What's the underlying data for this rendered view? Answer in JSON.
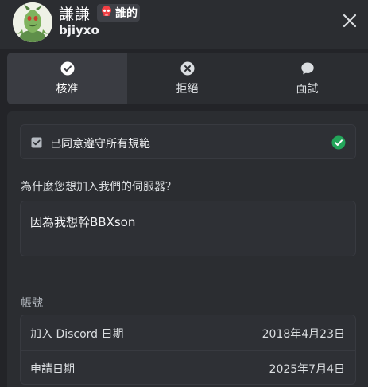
{
  "header": {
    "display_name": "謙謙",
    "server_tag": "誰的",
    "username": "bjiyxo"
  },
  "actions": [
    {
      "label": "核准",
      "icon": "check-circle-icon",
      "active": true
    },
    {
      "label": "拒絕",
      "icon": "x-circle-icon",
      "active": false
    },
    {
      "label": "面試",
      "icon": "chat-bubble-icon",
      "active": false
    }
  ],
  "rules": {
    "label": "已同意遵守所有規範"
  },
  "question": {
    "prompt": "為什麼您想加入我們的伺服器？",
    "answer": "因為我想幹BBXson"
  },
  "account": {
    "title": "帳號",
    "rows": [
      {
        "label": "加入 Discord 日期",
        "value": "2018年4月23日"
      },
      {
        "label": "申請日期",
        "value": "2025年7月4日"
      }
    ]
  },
  "colors": {
    "background": "#232428",
    "panel": "#2b2d31",
    "active_tab": "#3a3c42",
    "success": "#23a55a",
    "skull": "#f23f43"
  }
}
